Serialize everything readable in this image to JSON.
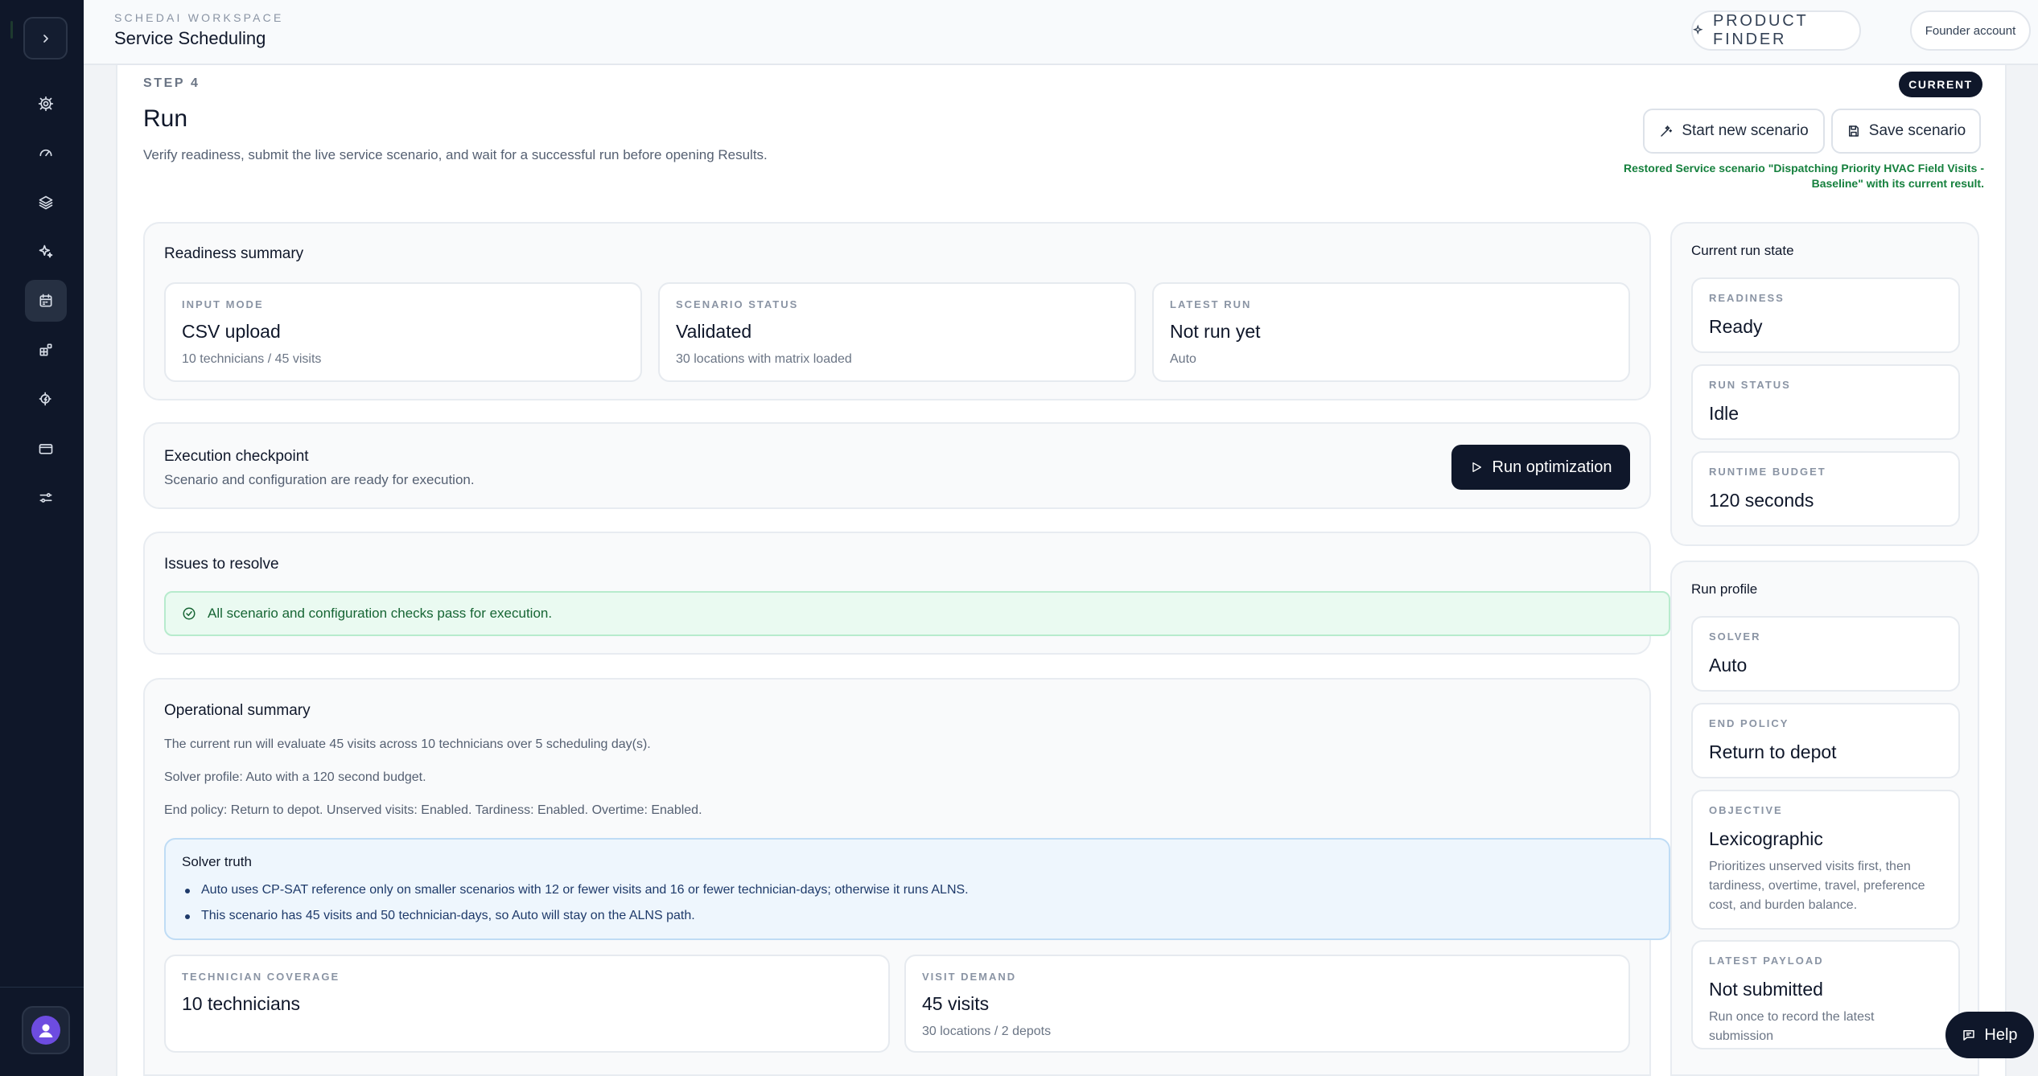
{
  "header": {
    "workspace_label": "SCHEDAI WORKSPACE",
    "workspace_title": "Service Scheduling",
    "product_finder_label": "PRODUCT FINDER",
    "account_label": "Founder account"
  },
  "sidebar": {
    "items": [
      {
        "icon": "settings-icon",
        "active": false
      },
      {
        "icon": "gauge-icon",
        "active": false
      },
      {
        "icon": "layers-icon",
        "active": false
      },
      {
        "icon": "sparkles-icon",
        "active": false
      },
      {
        "icon": "calendar-icon",
        "active": true
      },
      {
        "icon": "blocks-icon",
        "active": false
      },
      {
        "icon": "cog-bolt-icon",
        "active": false
      },
      {
        "icon": "credit-card-icon",
        "active": false
      },
      {
        "icon": "sliders-icon",
        "active": false
      }
    ]
  },
  "page": {
    "step_label": "STEP 4",
    "title": "Run",
    "description": "Verify readiness, submit the live service scenario, and wait for a successful run before opening Results.",
    "badge": "CURRENT",
    "start_new_label": "Start new scenario",
    "save_label": "Save scenario",
    "restored_message": "Restored Service scenario \"Dispatching Priority HVAC Field Visits - Baseline\" with its current result."
  },
  "readiness_summary": {
    "title": "Readiness summary",
    "tiles": [
      {
        "key": "INPUT MODE",
        "value": "CSV upload",
        "sub": "10 technicians / 45 visits"
      },
      {
        "key": "SCENARIO STATUS",
        "value": "Validated",
        "sub": "30 locations with matrix loaded"
      },
      {
        "key": "LATEST RUN",
        "value": "Not run yet",
        "sub": "Auto"
      }
    ]
  },
  "execution": {
    "title": "Execution checkpoint",
    "subtitle": "Scenario and configuration are ready for execution.",
    "run_label": "Run optimization"
  },
  "issues": {
    "title": "Issues to resolve",
    "message": "All scenario and configuration checks pass for execution."
  },
  "operational": {
    "title": "Operational summary",
    "lines": [
      "The current run will evaluate 45 visits across 10 technicians over 5 scheduling day(s).",
      "Solver profile: Auto with a 120 second budget.",
      "End policy: Return to depot. Unserved visits: Enabled. Tardiness: Enabled. Overtime: Enabled."
    ],
    "solver_truth_title": "Solver truth",
    "solver_truth_items": [
      "Auto uses CP-SAT reference only on smaller scenarios with 12 or fewer visits and 16 or fewer technician-days; otherwise it runs ALNS.",
      "This scenario has 45 visits and 50 technician-days, so Auto will stay on the ALNS path."
    ],
    "tiles": [
      {
        "key": "TECHNICIAN COVERAGE",
        "value": "10 technicians",
        "sub": ""
      },
      {
        "key": "VISIT DEMAND",
        "value": "45 visits",
        "sub": "30 locations / 2 depots"
      }
    ]
  },
  "run_state": {
    "title": "Current run state",
    "tiles": [
      {
        "key": "READINESS",
        "value": "Ready"
      },
      {
        "key": "RUN STATUS",
        "value": "Idle"
      },
      {
        "key": "RUNTIME BUDGET",
        "value": "120 seconds"
      }
    ]
  },
  "run_profile": {
    "title": "Run profile",
    "tiles": [
      {
        "key": "SOLVER",
        "value": "Auto",
        "sub": ""
      },
      {
        "key": "END POLICY",
        "value": "Return to depot",
        "sub": ""
      },
      {
        "key": "OBJECTIVE",
        "value": "Lexicographic",
        "sub": "Prioritizes unserved visits first, then tardiness, overtime, travel, preference cost, and burden balance."
      },
      {
        "key": "LATEST PAYLOAD",
        "value": "Not submitted",
        "sub": "Run once to record the latest submission"
      }
    ]
  },
  "help_label": "Help"
}
